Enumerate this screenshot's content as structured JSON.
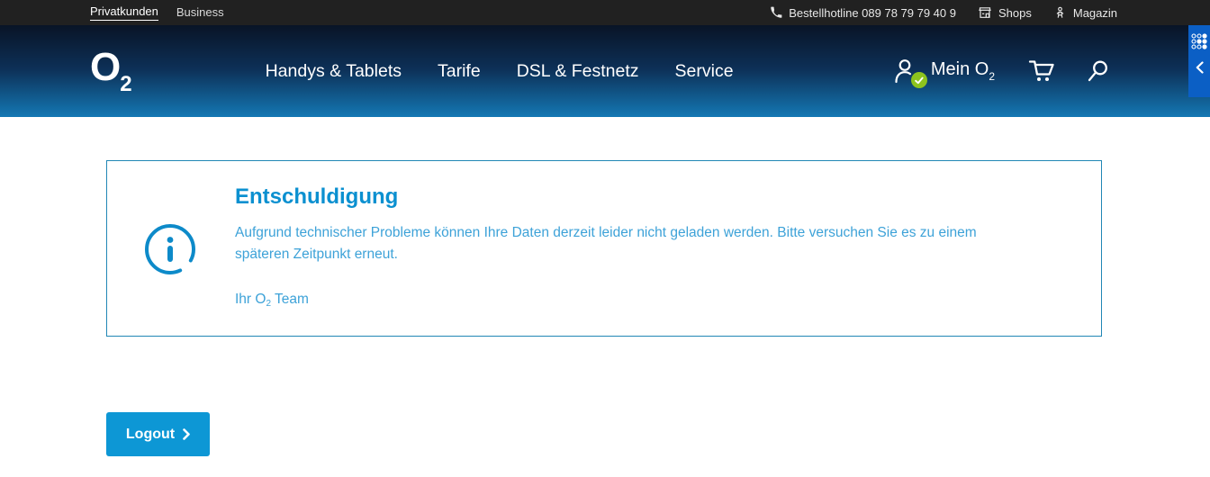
{
  "top_bar": {
    "left_items": [
      {
        "label": "Privatkunden",
        "active": true
      },
      {
        "label": "Business",
        "active": false
      }
    ],
    "hotline_label": "Bestellhotline 089 78 79 79 40 9",
    "shops_label": "Shops",
    "magazin_label": "Magazin"
  },
  "nav": {
    "logo_prefix": "O",
    "logo_sub": "2",
    "links": [
      "Handys & Tablets",
      "Tarife",
      "DSL & Festnetz",
      "Service"
    ],
    "account_label_prefix": "Mein O",
    "account_label_sub": "2"
  },
  "message_box": {
    "title": "Entschuldigung",
    "body": "Aufgrund technischer Probleme können Ihre Daten derzeit leider nicht geladen werden. Bitte versuchen Sie es zu einem späteren Zeitpunkt erneut.",
    "signature_prefix": "Ihr O",
    "signature_sub": "2",
    "signature_suffix": " Team"
  },
  "actions": {
    "logout_label": "Logout"
  },
  "icons": {
    "phone": "✆",
    "shops": "storefront",
    "magazin": "person-figure",
    "account": "person-with-check-badge",
    "cart": "shopping-cart",
    "search": "magnifier",
    "info": "info-circle",
    "chevron_right": "›",
    "chevron_left": "‹",
    "dots_grid": "accessibility-dot-grid"
  },
  "colors": {
    "top_bar_bg": "#212121",
    "nav_gradient_top": "#091426",
    "nav_gradient_bottom": "#1478b4",
    "accent_heading": "#0b90d0",
    "body_text": "#3da2d8",
    "box_border": "#2187b5",
    "button_bg": "#0d97d5",
    "badge_green": "#8dc41e",
    "side_widget_blue": "#0b5fc5"
  }
}
